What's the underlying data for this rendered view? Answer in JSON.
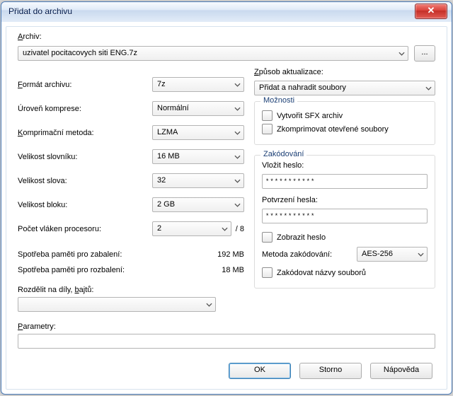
{
  "window": {
    "title": "Přidat do archivu",
    "close_glyph": "✕"
  },
  "archive": {
    "label_html": "Archiv:",
    "value": "uzivatel pocitacovych siti ENG.7z",
    "browse": "..."
  },
  "left": {
    "format": {
      "label": "Formát archivu:",
      "value": "7z"
    },
    "level": {
      "label": "Úroveň komprese:",
      "value": "Normální"
    },
    "method": {
      "label": "Komprimační metoda:",
      "value": "LZMA"
    },
    "dict": {
      "label": "Velikost slovníku:",
      "value": "16 MB"
    },
    "word": {
      "label": "Velikost slova:",
      "value": "32"
    },
    "block": {
      "label": "Velikost bloku:",
      "value": "2 GB"
    },
    "threads": {
      "label": "Počet vláken procesoru:",
      "value": "2",
      "suffix": "/ 8"
    },
    "mem_pack": {
      "label": "Spotřeba paměti pro zabalení:",
      "value": "192 MB"
    },
    "mem_unpack": {
      "label": "Spotřeba paměti pro rozbalení:",
      "value": "18 MB"
    },
    "split": {
      "label": "Rozdělit na díly, bajtů:",
      "value": ""
    }
  },
  "right": {
    "update": {
      "label": "Způsob aktualizace:",
      "value": "Přidat a nahradit soubory"
    },
    "options": {
      "legend": "Možnosti",
      "sfx": "Vytvořit SFX archiv",
      "open_files": "Zkomprimovat otevřené soubory"
    },
    "encryption": {
      "legend": "Zakódování",
      "pw_label": "Vložit heslo:",
      "pw_value": "***********",
      "pw2_label": "Potvrzení hesla:",
      "pw2_value": "***********",
      "show_pw": "Zobrazit heslo",
      "method_label": "Metoda zakódování:",
      "method_value": "AES-256",
      "encrypt_names": "Zakódovat názvy souborů"
    }
  },
  "params": {
    "label": "Parametry:",
    "value": ""
  },
  "buttons": {
    "ok": "OK",
    "cancel": "Storno",
    "help": "Nápověda"
  }
}
